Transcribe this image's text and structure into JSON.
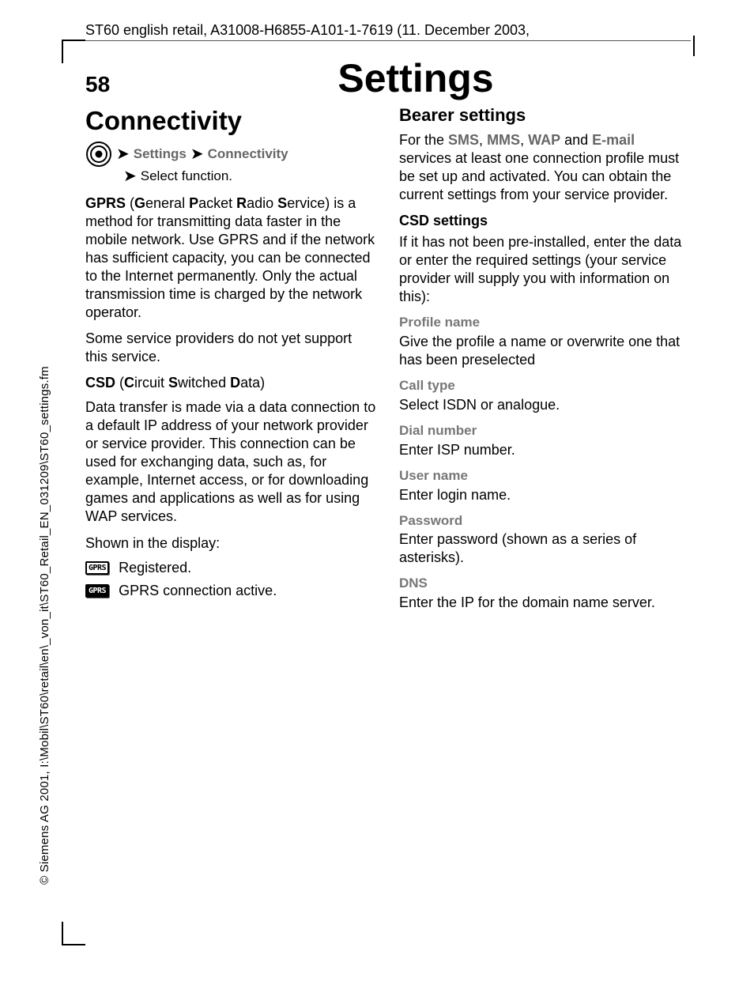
{
  "meta": {
    "header": "ST60 english retail, A31008-H6855-A101-1-7619 (11. December 2003,",
    "spine": "© Siemens AG 2001, I:\\Mobil\\ST60\\retail\\en\\_von_it\\ST60_Retail_EN_031209\\ST60_settings.fm",
    "page_number": "58",
    "title": "Settings"
  },
  "left": {
    "section_title": "Connectivity",
    "nav": {
      "settings": "Settings",
      "connectivity": "Connectivity",
      "select_fn": "Select function."
    },
    "gprs_def_prefix": "GPRS",
    "gprs_def_open": " (",
    "gprs_G": "G",
    "gprs_eneral": "eneral ",
    "gprs_P": "P",
    "gprs_acket": "acket ",
    "gprs_R": "R",
    "gprs_adio": "adio ",
    "gprs_S": "S",
    "gprs_ervice": "ervice) ",
    "gprs_body": "is a method for transmitting data faster in the mobile network. Use GPRS and if the network has sufficient capacity, you can be connected to the Internet permanently. Only the actual transmission time is charged by the network operator.",
    "gprs_note": "Some service providers do not yet support this service.",
    "csd_prefix": "CSD",
    "csd_open": " (",
    "csd_C": "C",
    "csd_ircuit": "ircuit ",
    "csd_S": "S",
    "csd_witched": "witched ",
    "csd_D": "D",
    "csd_ata": "ata)",
    "csd_body": "Data transfer is made via a data connection to a default IP address of your network provider or service provider. This connection can be used for exchanging data, such as, for example, Internet access, or for downloading games and applications as well as for using WAP services.",
    "shown": "Shown in the display:",
    "badge1": "GPRS",
    "badge1_text": "Registered.",
    "badge2": "GPRS",
    "badge2_text": "GPRS connection active."
  },
  "right": {
    "section_title": "Bearer settings",
    "intro_pre": "For the ",
    "sms": "SMS",
    "c1": ", ",
    "mms": "MMS",
    "c2": ", ",
    "wap": "WAP",
    "and": " and ",
    "email": "E-mail",
    "intro_post": " services at least one connection profile must be set up and activated. You can obtain the current settings from your service provider.",
    "csd_settings": "CSD settings",
    "csd_settings_body": "If it has not been pre-installed, enter the data or enter the required settings (your service provider will supply you with information on this):",
    "profile_name": "Profile name",
    "profile_name_body": "Give the profile a name or overwrite one that has been preselected",
    "call_type": "Call type",
    "call_type_body": "Select ISDN or analogue.",
    "dial_number": "Dial number",
    "dial_number_body": "Enter ISP number.",
    "user_name": "User name",
    "user_name_body": "Enter login name.",
    "password": "Password",
    "password_body": "Enter password (shown as a series of asterisks).",
    "dns": "DNS",
    "dns_body": "Enter the IP for the domain name server."
  }
}
